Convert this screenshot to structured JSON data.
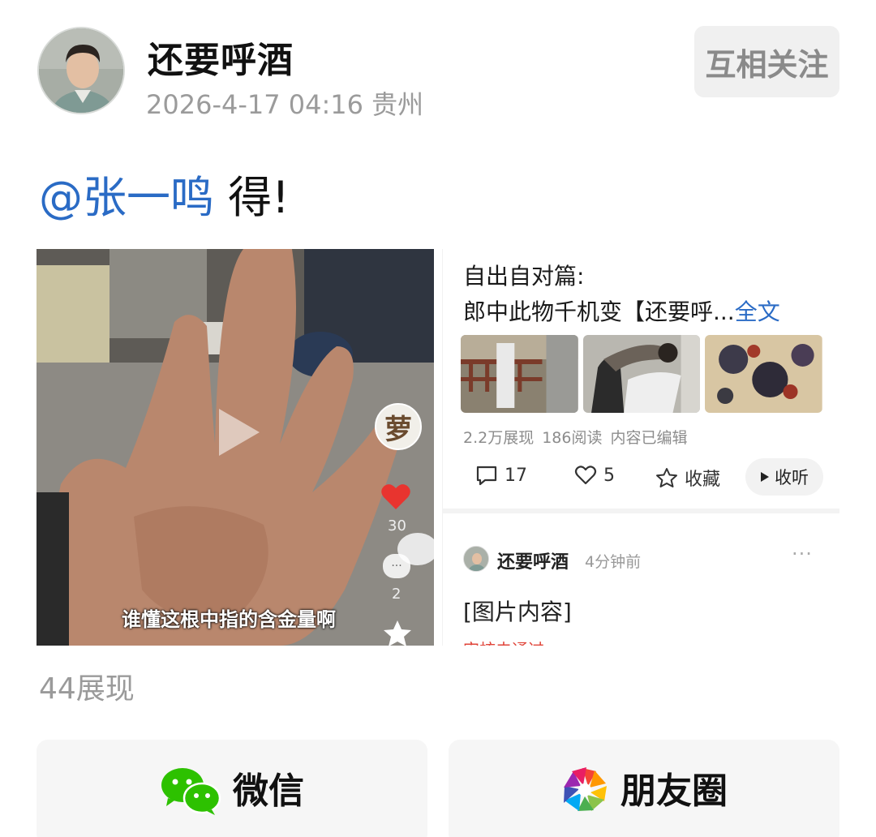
{
  "header": {
    "username": "还要呼酒",
    "meta": "2026-4-17 04:16 贵州",
    "follow_label": "互相关注"
  },
  "post": {
    "mention": "@张一鸣",
    "text": " 得!"
  },
  "video": {
    "caption": "谁懂这根中指的含金量啊",
    "side_avatar_char": "萝",
    "like_count": "30",
    "comment_count": "2",
    "comment_bubble": "···"
  },
  "article": {
    "title_line1": "自出自对篇:",
    "title_line2": "郎中此物千机变【还要呼...",
    "fulltext_link": "全文",
    "stats": {
      "views": "2.2万展现",
      "reads": "186阅读",
      "edited": "内容已编辑"
    },
    "comment_count": "17",
    "like_count": "5",
    "favorite_label": "收藏",
    "listen_label": "收听",
    "comment": {
      "name": "还要呼酒",
      "time": "4分钟前",
      "more": "···",
      "content": "[图片内容]",
      "status": "审核未通过"
    }
  },
  "views_label": "44展现",
  "share": {
    "wechat_label": "微信",
    "moments_label": "朋友圈"
  },
  "colors": {
    "link_blue": "#2a6bc5",
    "wechat_green": "#2dc100",
    "heart_red": "#e8342f"
  }
}
